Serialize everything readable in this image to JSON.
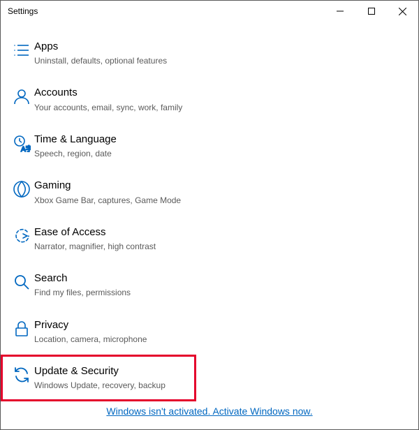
{
  "window": {
    "title": "Settings"
  },
  "settings": {
    "items": [
      {
        "title": "Apps",
        "desc": "Uninstall, defaults, optional features"
      },
      {
        "title": "Accounts",
        "desc": "Your accounts, email, sync, work, family"
      },
      {
        "title": "Time & Language",
        "desc": "Speech, region, date"
      },
      {
        "title": "Gaming",
        "desc": "Xbox Game Bar, captures, Game Mode"
      },
      {
        "title": "Ease of Access",
        "desc": "Narrator, magnifier, high contrast"
      },
      {
        "title": "Search",
        "desc": "Find my files, permissions"
      },
      {
        "title": "Privacy",
        "desc": "Location, camera, microphone"
      },
      {
        "title": "Update & Security",
        "desc": "Windows Update, recovery, backup"
      }
    ]
  },
  "activation": {
    "text": "Windows isn't activated. Activate Windows now."
  }
}
